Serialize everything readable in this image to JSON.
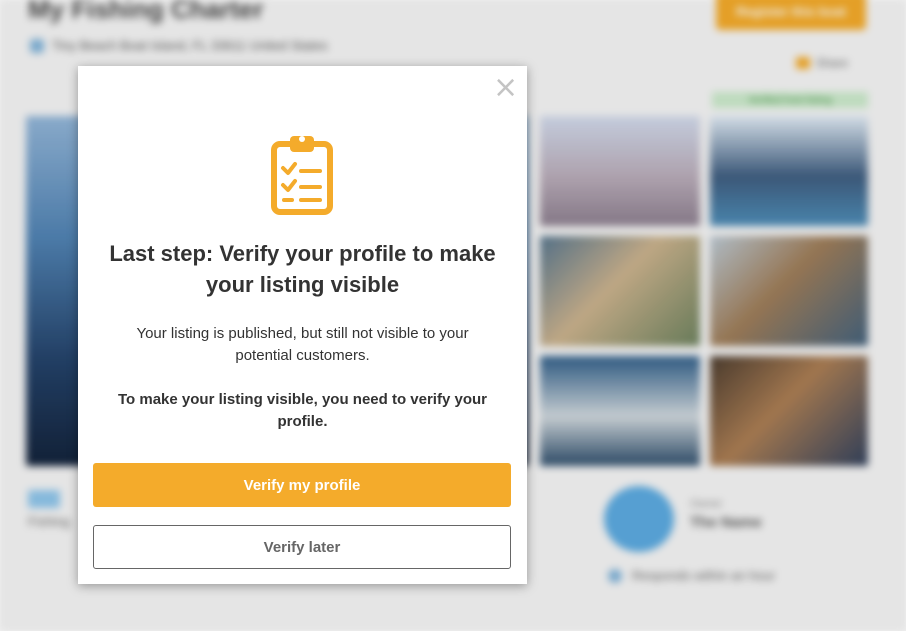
{
  "background": {
    "title": "My Fishing Charter",
    "location": "Tiny Beach Boat Island, FL 33611 United States",
    "top_button": "Register this boat",
    "share": "Share",
    "badge": "Verified host listing",
    "host_label": "Owner",
    "host_name": "The Name",
    "response": "Responds within an hour",
    "left_text": "Fishing",
    "colors": {
      "accent": "#f2a825",
      "avatar": "#58a8df"
    }
  },
  "modal": {
    "close_icon": "close-icon",
    "icon": "clipboard-checklist-icon",
    "title": "Last step: Verify your profile to make your listing visible",
    "body": "Your listing is published, but still not visible to your potential customers.",
    "emphasis": "To make your listing visible, you need to verify your profile.",
    "primary_button": "Verify my profile",
    "secondary_button": "Verify later",
    "colors": {
      "primary": "#f4ab2b",
      "text": "#333333"
    }
  }
}
